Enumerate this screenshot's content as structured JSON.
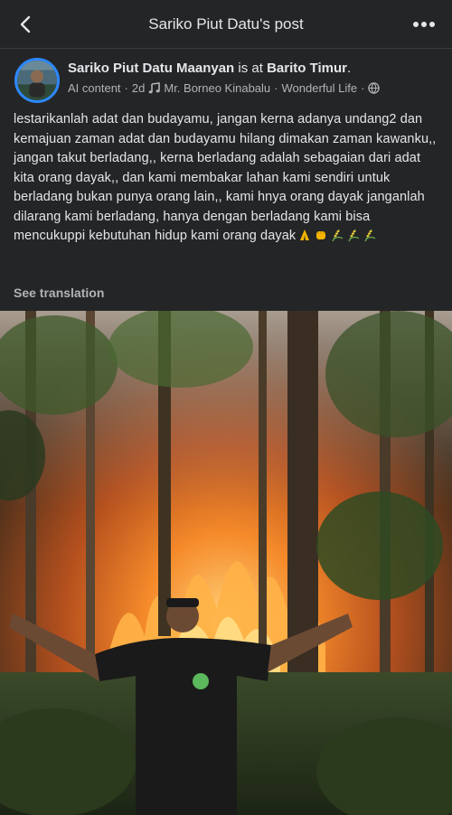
{
  "topbar": {
    "title": "Sariko Piut Datu's post",
    "back_icon": "chevron-left-icon",
    "more_icon": "more-horizontal-icon"
  },
  "post": {
    "author": "Sariko Piut Datu Maanyan",
    "is_at": " is at ",
    "location": "Barito Timur",
    "location_suffix": ".",
    "meta_label": "AI content",
    "time": "2d",
    "music": "Mr. Borneo Kinabalu",
    "song": "Wonderful Life",
    "text": "lestarikanlah adat dan budayamu, jangan kerna adanya undang2 dan kemajuan zaman adat dan budayamu hilang dimakan zaman kawanku,, jangan takut berladang,, kerna berladang adalah sebagaian dari adat kita orang dayak,, dan kami membakar lahan kami sendiri untuk berladang bukan punya orang lain,, kami hnya orang dayak janganlah dilarang kami berladang, hanya dengan berladang kami bisa mencukuppi kebutuhan hidup kami orang dayak",
    "emojis": [
      "praying-hands-icon",
      "fist-icon",
      "rice-plant-icon",
      "rice-plant-icon",
      "rice-plant-icon"
    ],
    "see_translation": "See translation"
  },
  "colors": {
    "background": "#242526",
    "text": "#e4e6eb",
    "secondary": "#b0b3b8",
    "avatar_ring": "#2d88ff"
  }
}
